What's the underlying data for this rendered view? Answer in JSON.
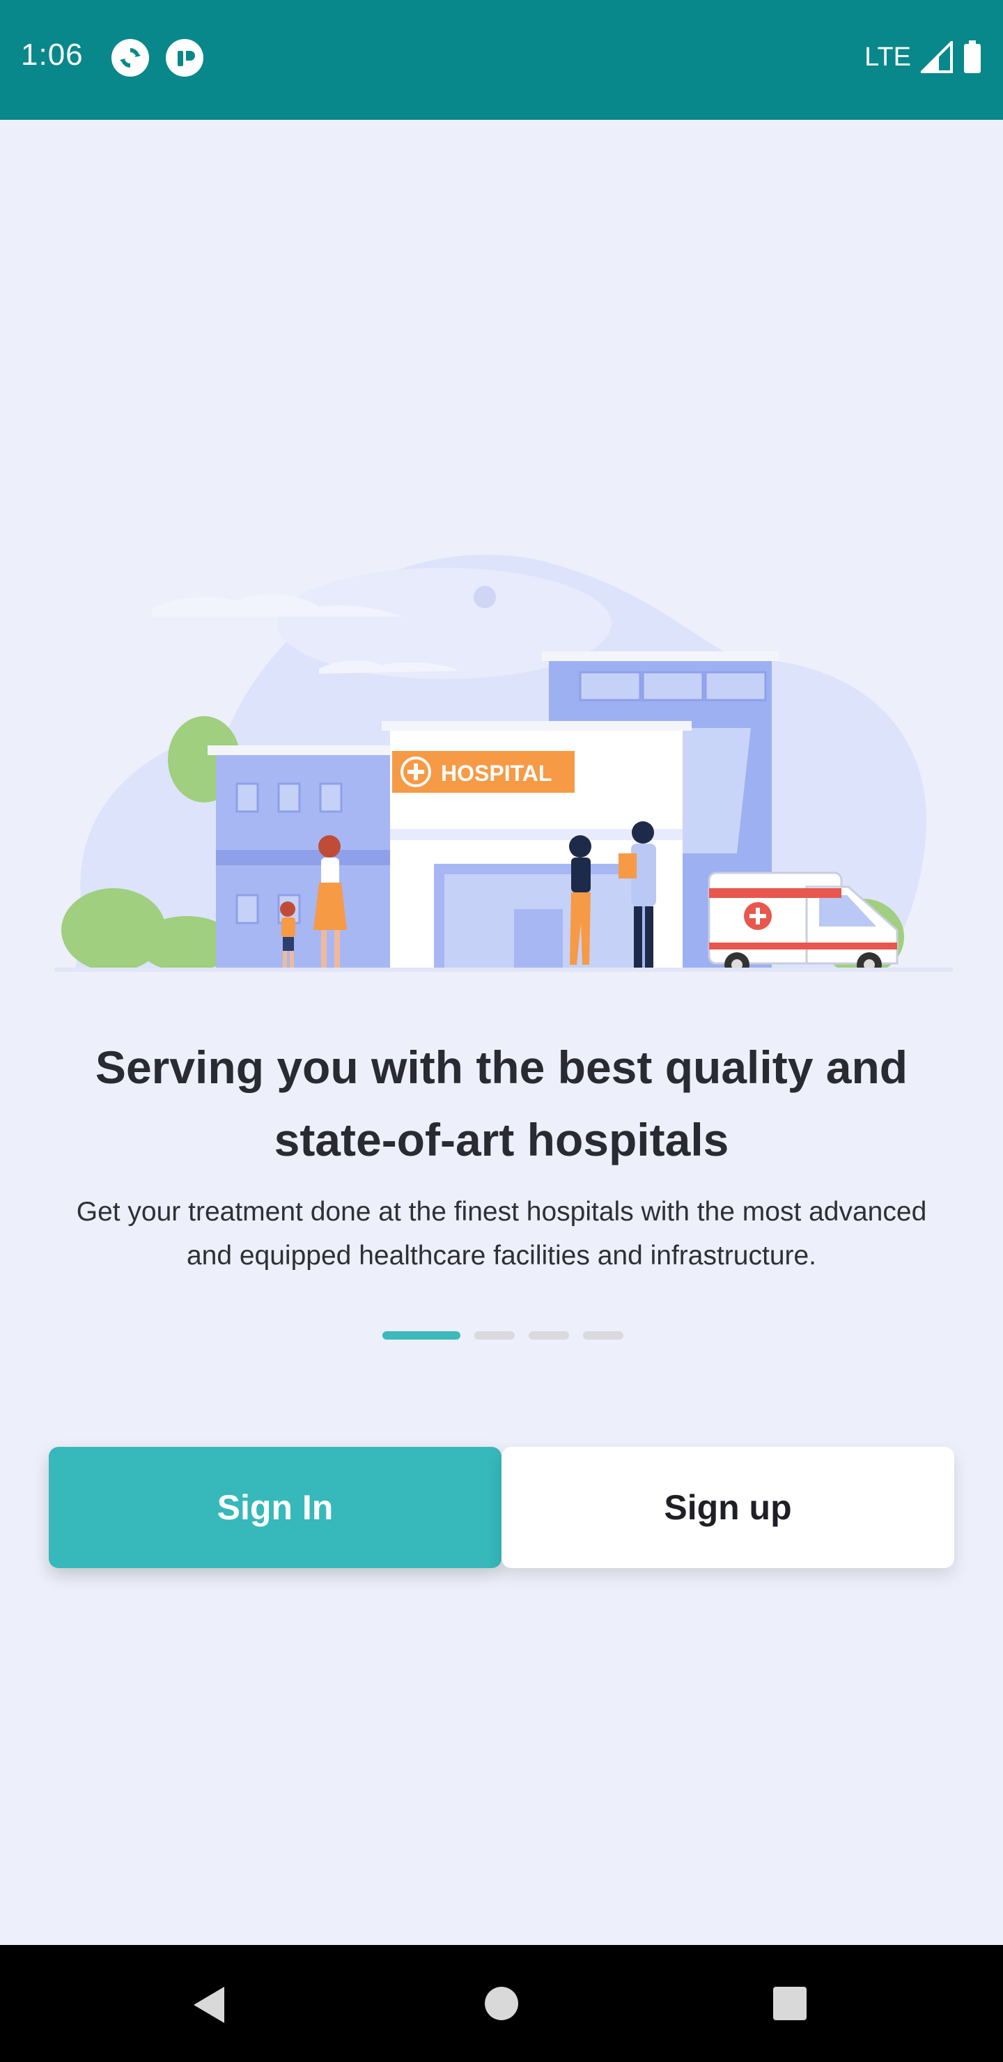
{
  "status_bar": {
    "time": "1:06",
    "network": "LTE",
    "icons": [
      "sync-app-icon",
      "pause-app-icon",
      "signal-icon",
      "battery-icon"
    ]
  },
  "hero": {
    "sign_text": "HOSPITAL",
    "icon": "hospital-illustration"
  },
  "onboarding": {
    "title_line1": "Serving you with the best quality and",
    "title_line2": "state-of-art hospitals",
    "subtitle_line1": "Get your treatment done at the finest hospitals with the most advanced",
    "subtitle_line2": "and equipped healthcare facilities and infrastructure.",
    "page_indicator": {
      "current": 1,
      "total": 4
    }
  },
  "buttons": {
    "sign_in": "Sign In",
    "sign_up": "Sign up"
  },
  "nav": {
    "icons": [
      "back-icon",
      "home-icon",
      "recents-icon"
    ]
  },
  "colors": {
    "status_bar": "#08888a",
    "accent": "#37b8ba",
    "background": "#edeffa"
  }
}
